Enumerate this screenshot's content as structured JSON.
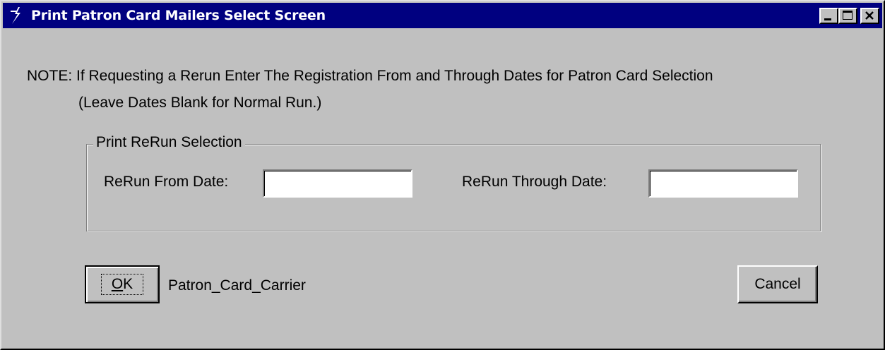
{
  "window": {
    "title": "Print Patron Card Mailers  Select Screen",
    "icon": "app-icon",
    "controls": [
      "minimize-icon",
      "maximize-icon",
      "close-icon"
    ]
  },
  "note": {
    "line1": "NOTE: If Requesting a Rerun Enter The Registration From and Through Dates for Patron Card Selection",
    "line2": "(Leave Dates Blank for Normal Run.)"
  },
  "group": {
    "legend": "Print ReRun Selection",
    "from_label": "ReRun From Date:",
    "from_value": "",
    "through_label": "ReRun Through Date:",
    "through_value": ""
  },
  "buttons": {
    "ok_prefix": "",
    "ok_accel": "O",
    "ok_rest": "K",
    "cancel": "Cancel"
  },
  "status_text": "Patron_Card_Carrier",
  "colors": {
    "titlebar": "#000080",
    "face": "#c0c0c0"
  }
}
